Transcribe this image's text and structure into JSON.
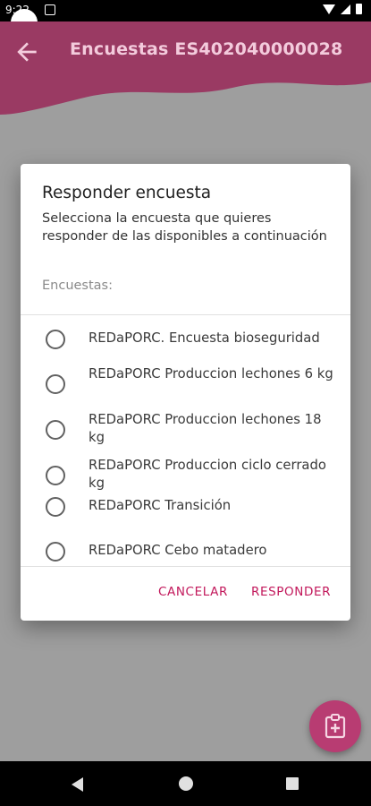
{
  "status_bar": {
    "time": "9:22"
  },
  "app_bar": {
    "title": "Encuestas ES402040000028"
  },
  "dialog": {
    "title": "Responder encuesta",
    "description": "Selecciona la encuesta que quieres responder de las disponibles a continuación",
    "list_label": "Encuestas:",
    "items": [
      {
        "label": "REDaPORC. Encuesta bioseguridad"
      },
      {
        "label": "REDaPORC Produccion lechones 6 kg"
      },
      {
        "label": "REDaPORC Produccion lechones 18 kg"
      },
      {
        "label": "REDaPORC Produccion ciclo cerrado kg"
      },
      {
        "label": "REDaPORC Transición"
      },
      {
        "label": "REDaPORC Cebo matadero"
      }
    ],
    "cancel_label": "CANCELAR",
    "respond_label": "RESPONDER"
  },
  "colors": {
    "accent": "#b83c72",
    "button_text": "#c2185b",
    "scrim": "#9e9e9e"
  },
  "icons": {
    "fab": "clipboard-plus-icon",
    "back": "arrow-back-icon"
  }
}
